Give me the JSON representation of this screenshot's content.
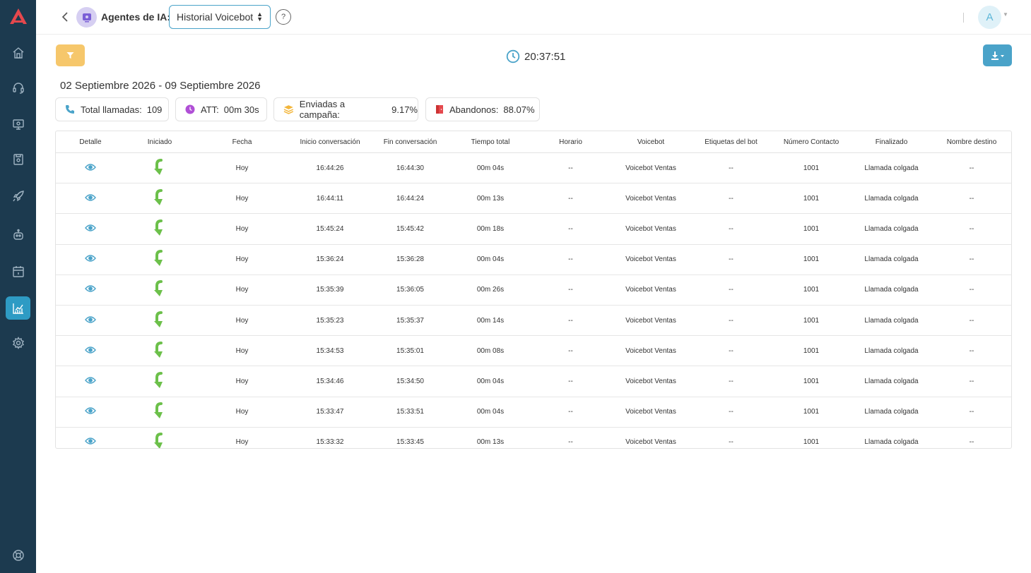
{
  "header": {
    "agent_label": "Agentes de IA:",
    "select_value": "Historial Voicebot",
    "help_label": "?",
    "user_initial": "A"
  },
  "toolbar": {
    "time": "20:37:51"
  },
  "date_range": "02 Septiembre 2026 - 09 Septiembre 2026",
  "stats": [
    {
      "label": "Total llamadas:",
      "value": "109",
      "icon": "phone-icon"
    },
    {
      "label": "ATT:",
      "value": "00m 30s",
      "icon": "clock-icon"
    },
    {
      "label": "Enviadas a campaña:",
      "value": "9.17%",
      "icon": "layers-icon"
    },
    {
      "label": "Abandonos:",
      "value": "88.07%",
      "icon": "door-icon"
    }
  ],
  "table": {
    "columns": [
      "Detalle",
      "Iniciado",
      "Fecha",
      "Inicio conversación",
      "Fin conversación",
      "Tiempo total",
      "Horario",
      "Voicebot",
      "Etiquetas del bot",
      "Número Contacto",
      "Finalizado",
      "Nombre destino"
    ],
    "rows": [
      {
        "fecha": "Hoy",
        "inicio": "16:44:26",
        "fin": "16:44:30",
        "total": "00m 04s",
        "horario": "--",
        "voicebot": "Voicebot Ventas",
        "etiquetas": "--",
        "numero": "1001",
        "finalizado": "Llamada colgada",
        "destino": "--"
      },
      {
        "fecha": "Hoy",
        "inicio": "16:44:11",
        "fin": "16:44:24",
        "total": "00m 13s",
        "horario": "--",
        "voicebot": "Voicebot Ventas",
        "etiquetas": "--",
        "numero": "1001",
        "finalizado": "Llamada colgada",
        "destino": "--"
      },
      {
        "fecha": "Hoy",
        "inicio": "15:45:24",
        "fin": "15:45:42",
        "total": "00m 18s",
        "horario": "--",
        "voicebot": "Voicebot Ventas",
        "etiquetas": "--",
        "numero": "1001",
        "finalizado": "Llamada colgada",
        "destino": "--"
      },
      {
        "fecha": "Hoy",
        "inicio": "15:36:24",
        "fin": "15:36:28",
        "total": "00m 04s",
        "horario": "--",
        "voicebot": "Voicebot Ventas",
        "etiquetas": "--",
        "numero": "1001",
        "finalizado": "Llamada colgada",
        "destino": "--"
      },
      {
        "fecha": "Hoy",
        "inicio": "15:35:39",
        "fin": "15:36:05",
        "total": "00m 26s",
        "horario": "--",
        "voicebot": "Voicebot Ventas",
        "etiquetas": "--",
        "numero": "1001",
        "finalizado": "Llamada colgada",
        "destino": "--"
      },
      {
        "fecha": "Hoy",
        "inicio": "15:35:23",
        "fin": "15:35:37",
        "total": "00m 14s",
        "horario": "--",
        "voicebot": "Voicebot Ventas",
        "etiquetas": "--",
        "numero": "1001",
        "finalizado": "Llamada colgada",
        "destino": "--"
      },
      {
        "fecha": "Hoy",
        "inicio": "15:34:53",
        "fin": "15:35:01",
        "total": "00m 08s",
        "horario": "--",
        "voicebot": "Voicebot Ventas",
        "etiquetas": "--",
        "numero": "1001",
        "finalizado": "Llamada colgada",
        "destino": "--"
      },
      {
        "fecha": "Hoy",
        "inicio": "15:34:46",
        "fin": "15:34:50",
        "total": "00m 04s",
        "horario": "--",
        "voicebot": "Voicebot Ventas",
        "etiquetas": "--",
        "numero": "1001",
        "finalizado": "Llamada colgada",
        "destino": "--"
      },
      {
        "fecha": "Hoy",
        "inicio": "15:33:47",
        "fin": "15:33:51",
        "total": "00m 04s",
        "horario": "--",
        "voicebot": "Voicebot Ventas",
        "etiquetas": "--",
        "numero": "1001",
        "finalizado": "Llamada colgada",
        "destino": "--"
      },
      {
        "fecha": "Hoy",
        "inicio": "15:33:32",
        "fin": "15:33:45",
        "total": "00m 13s",
        "horario": "--",
        "voicebot": "Voicebot Ventas",
        "etiquetas": "--",
        "numero": "1001",
        "finalizado": "Llamada colgada",
        "destino": "--"
      }
    ]
  },
  "colors": {
    "sidebar": "#1c3a4f",
    "accent": "#4aa3c9",
    "filter": "#f6c76b",
    "arrow": "#6cc04a"
  }
}
